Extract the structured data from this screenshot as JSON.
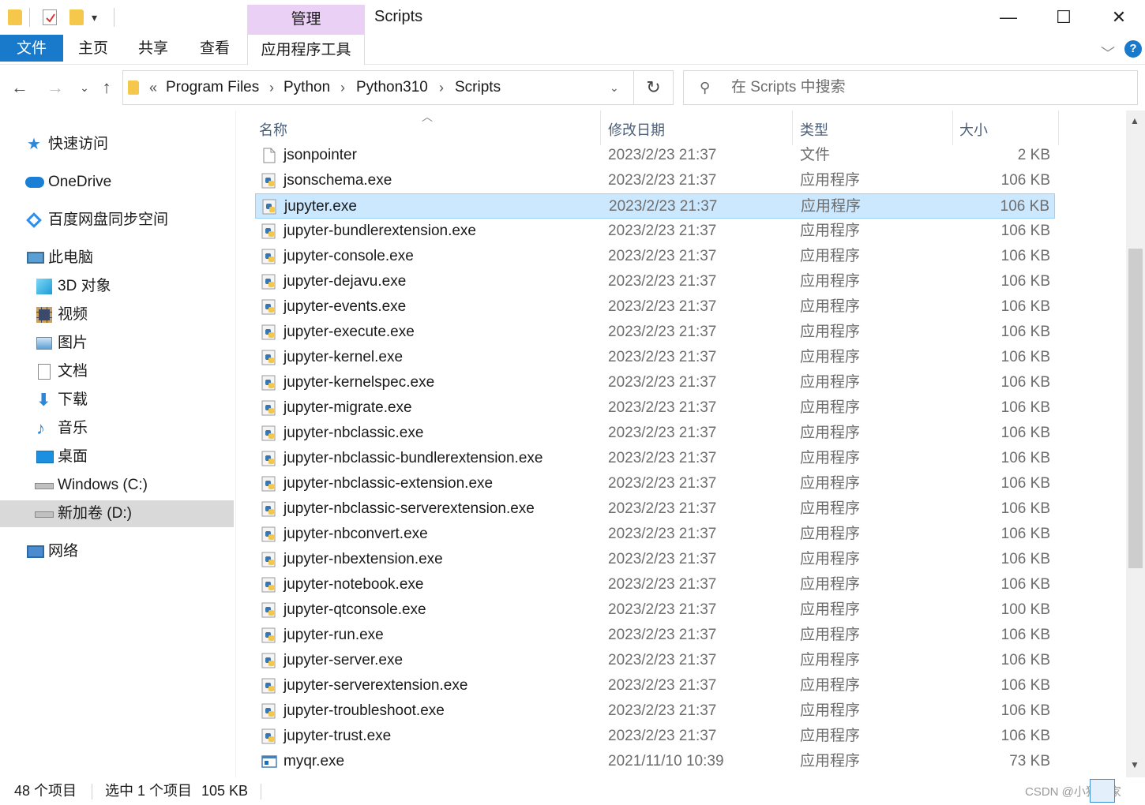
{
  "window": {
    "title": "Scripts",
    "manage_tab": "管理",
    "app_tools_tab": "应用程序工具",
    "minimize": "—",
    "maximize": "☐",
    "close": "✕"
  },
  "ribbon": {
    "tabs": [
      "文件",
      "主页",
      "共享",
      "查看"
    ],
    "help": "?"
  },
  "address": {
    "overflow": "«",
    "crumbs": [
      "Program Files",
      "Python",
      "Python310",
      "Scripts"
    ],
    "search_placeholder": "在 Scripts 中搜索"
  },
  "sidebar": {
    "items": [
      {
        "label": "快速访问",
        "icon": "star-icon"
      },
      {
        "label": "OneDrive",
        "icon": "cloud-icon"
      },
      {
        "label": "百度网盘同步空间",
        "icon": "baidu-icon"
      },
      {
        "label": "此电脑",
        "icon": "computer-icon"
      },
      {
        "label": "3D 对象",
        "icon": "cube-icon"
      },
      {
        "label": "视频",
        "icon": "video-icon"
      },
      {
        "label": "图片",
        "icon": "picture-icon"
      },
      {
        "label": "文档",
        "icon": "document-icon"
      },
      {
        "label": "下载",
        "icon": "download-icon"
      },
      {
        "label": "音乐",
        "icon": "music-icon"
      },
      {
        "label": "桌面",
        "icon": "desktop-icon"
      },
      {
        "label": "Windows (C:)",
        "icon": "drive-c-icon"
      },
      {
        "label": "新加卷 (D:)",
        "icon": "drive-d-icon",
        "selected": true
      },
      {
        "label": "网络",
        "icon": "network-icon"
      }
    ]
  },
  "columns": {
    "name": "名称",
    "date": "修改日期",
    "type": "类型",
    "size": "大小"
  },
  "files": [
    {
      "name": "jsonpointer",
      "date": "2023/2/23 21:37",
      "type": "文件",
      "size": "2 KB",
      "icon": "file"
    },
    {
      "name": "jsonschema.exe",
      "date": "2023/2/23 21:37",
      "type": "应用程序",
      "size": "106 KB",
      "icon": "python"
    },
    {
      "name": "jupyter.exe",
      "date": "2023/2/23 21:37",
      "type": "应用程序",
      "size": "106 KB",
      "icon": "python",
      "selected": true
    },
    {
      "name": "jupyter-bundlerextension.exe",
      "date": "2023/2/23 21:37",
      "type": "应用程序",
      "size": "106 KB",
      "icon": "python"
    },
    {
      "name": "jupyter-console.exe",
      "date": "2023/2/23 21:37",
      "type": "应用程序",
      "size": "106 KB",
      "icon": "python"
    },
    {
      "name": "jupyter-dejavu.exe",
      "date": "2023/2/23 21:37",
      "type": "应用程序",
      "size": "106 KB",
      "icon": "python"
    },
    {
      "name": "jupyter-events.exe",
      "date": "2023/2/23 21:37",
      "type": "应用程序",
      "size": "106 KB",
      "icon": "python"
    },
    {
      "name": "jupyter-execute.exe",
      "date": "2023/2/23 21:37",
      "type": "应用程序",
      "size": "106 KB",
      "icon": "python"
    },
    {
      "name": "jupyter-kernel.exe",
      "date": "2023/2/23 21:37",
      "type": "应用程序",
      "size": "106 KB",
      "icon": "python"
    },
    {
      "name": "jupyter-kernelspec.exe",
      "date": "2023/2/23 21:37",
      "type": "应用程序",
      "size": "106 KB",
      "icon": "python"
    },
    {
      "name": "jupyter-migrate.exe",
      "date": "2023/2/23 21:37",
      "type": "应用程序",
      "size": "106 KB",
      "icon": "python"
    },
    {
      "name": "jupyter-nbclassic.exe",
      "date": "2023/2/23 21:37",
      "type": "应用程序",
      "size": "106 KB",
      "icon": "python"
    },
    {
      "name": "jupyter-nbclassic-bundlerextension.exe",
      "date": "2023/2/23 21:37",
      "type": "应用程序",
      "size": "106 KB",
      "icon": "python"
    },
    {
      "name": "jupyter-nbclassic-extension.exe",
      "date": "2023/2/23 21:37",
      "type": "应用程序",
      "size": "106 KB",
      "icon": "python"
    },
    {
      "name": "jupyter-nbclassic-serverextension.exe",
      "date": "2023/2/23 21:37",
      "type": "应用程序",
      "size": "106 KB",
      "icon": "python"
    },
    {
      "name": "jupyter-nbconvert.exe",
      "date": "2023/2/23 21:37",
      "type": "应用程序",
      "size": "106 KB",
      "icon": "python"
    },
    {
      "name": "jupyter-nbextension.exe",
      "date": "2023/2/23 21:37",
      "type": "应用程序",
      "size": "106 KB",
      "icon": "python"
    },
    {
      "name": "jupyter-notebook.exe",
      "date": "2023/2/23 21:37",
      "type": "应用程序",
      "size": "106 KB",
      "icon": "python"
    },
    {
      "name": "jupyter-qtconsole.exe",
      "date": "2023/2/23 21:37",
      "type": "应用程序",
      "size": "100 KB",
      "icon": "python"
    },
    {
      "name": "jupyter-run.exe",
      "date": "2023/2/23 21:37",
      "type": "应用程序",
      "size": "106 KB",
      "icon": "python"
    },
    {
      "name": "jupyter-server.exe",
      "date": "2023/2/23 21:37",
      "type": "应用程序",
      "size": "106 KB",
      "icon": "python"
    },
    {
      "name": "jupyter-serverextension.exe",
      "date": "2023/2/23 21:37",
      "type": "应用程序",
      "size": "106 KB",
      "icon": "python"
    },
    {
      "name": "jupyter-troubleshoot.exe",
      "date": "2023/2/23 21:37",
      "type": "应用程序",
      "size": "106 KB",
      "icon": "python"
    },
    {
      "name": "jupyter-trust.exe",
      "date": "2023/2/23 21:37",
      "type": "应用程序",
      "size": "106 KB",
      "icon": "python"
    },
    {
      "name": "myqr.exe",
      "date": "2021/11/10 10:39",
      "type": "应用程序",
      "size": "73 KB",
      "icon": "app"
    }
  ],
  "status": {
    "count": "48 个项目",
    "selection": "选中 1 个项目",
    "selection_size": "105 KB"
  },
  "watermark": "CSDN @小猪在家",
  "colors": {
    "accent": "#1979ca",
    "manage_tab": "#ead0f5",
    "selected_row": "#cce8ff",
    "selected_border": "#99d1ff"
  }
}
